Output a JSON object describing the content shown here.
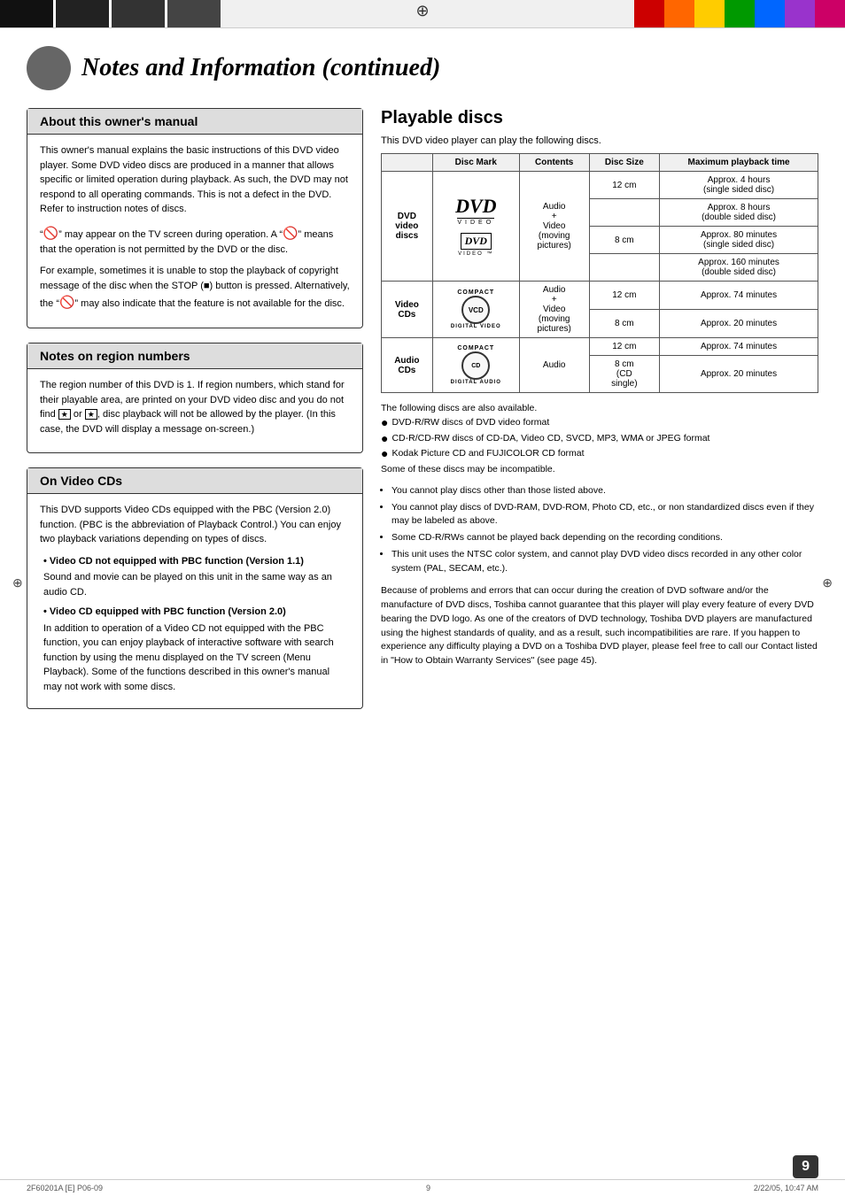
{
  "top_bar": {
    "colors": [
      "#c00",
      "#f60",
      "#fc0",
      "#0a0",
      "#06c",
      "#90c",
      "#c09"
    ]
  },
  "page_title": "Notes and Information (continued)",
  "about_manual": {
    "title": "About this owner's manual",
    "paragraphs": [
      "This owner's manual explains the basic instructions of this DVD video player. Some DVD video discs are produced in a manner that allows specific or limited operation during playback. As such, the DVD may not respond to all operating commands. This is not a defect in the DVD. Refer to instruction notes of discs.",
      "\" \" may appear on the TV screen during operation. A \" \" means that the operation is not permitted by the DVD or the disc.",
      "For example, sometimes it is unable to stop the playback of copyright message of the disc when the STOP (■) button is pressed. Alternatively, the \" \" may also indicate that the feature is not available for the disc."
    ]
  },
  "notes_region": {
    "title": "Notes on region numbers",
    "text": "The region number of this DVD is 1. If region numbers, which stand for their playable area, are printed on your DVD video disc and you do not find  or  , disc playback will not be allowed by the player. (In this case, the DVD will display a message on-screen.)"
  },
  "on_video_cds": {
    "title": "On Video CDs",
    "intro": "This DVD supports Video CDs equipped with the PBC (Version 2.0) function. (PBC is the abbreviation of Playback Control.) You can enjoy two playback variations depending on types of discs.",
    "items": [
      {
        "label": "Video CD not equipped with PBC function (Version 1.1)",
        "text": "Sound and movie can be played on this unit in the same way as an audio CD."
      },
      {
        "label": "Video CD equipped with PBC function (Version 2.0)",
        "text": "In addition to operation of a Video CD not equipped with the PBC function, you can enjoy playback of interactive software with search function by using the menu displayed on the TV screen (Menu Playback). Some of the functions described in this owner's manual may not work with some discs."
      }
    ]
  },
  "playable_discs": {
    "title": "Playable discs",
    "subtitle": "This DVD video player can play the following discs.",
    "table_headers": [
      "",
      "Disc Mark",
      "Contents",
      "Disc Size",
      "Maximum playback time"
    ],
    "rows": [
      {
        "category": "DVD video discs",
        "disc_mark": "DVD VIDEO (large + small)",
        "contents": "Audio + Video (moving pictures)",
        "sizes": [
          {
            "size": "12 cm",
            "times": [
              "Approx. 4 hours (single sided disc)",
              "Approx. 8 hours (double sided disc)"
            ]
          },
          {
            "size": "8 cm",
            "times": [
              "Approx. 80 minutes (single sided disc)",
              "Approx. 160 minutes (double sided disc)"
            ]
          }
        ]
      },
      {
        "category": "Video CDs",
        "disc_mark": "COMPACT VCD DIGITAL VIDEO",
        "contents": "Audio + Video (moving pictures)",
        "sizes": [
          {
            "size": "12 cm",
            "times": [
              "Approx. 74 minutes"
            ]
          },
          {
            "size": "8 cm",
            "times": [
              "Approx. 20 minutes"
            ]
          }
        ]
      },
      {
        "category": "Audio CDs",
        "disc_mark": "COMPACT CD DIGITAL AUDIO",
        "contents": "Audio",
        "sizes": [
          {
            "size": "12 cm",
            "times": [
              "Approx. 74 minutes"
            ]
          },
          {
            "size": "8 cm (CD single)",
            "times": [
              "Approx. 20 minutes"
            ]
          }
        ]
      }
    ],
    "also_available": {
      "intro": "The following discs are also available.",
      "items": [
        "DVD-R/RW discs of DVD video format",
        "CD-R/CD-RW discs of CD-DA, Video CD, SVCD, MP3, WMA or JPEG format",
        "Kodak Picture CD and FUJICOLOR CD format"
      ],
      "note": "Some of these discs may be incompatible."
    },
    "warnings": [
      "You cannot play discs other than those listed above.",
      "You cannot play discs of DVD-RAM, DVD-ROM, Photo CD, etc., or non standardized discs even if they may be labeled as above.",
      "Some CD-R/RWs cannot be played back depending on the recording conditions.",
      "This unit uses the NTSC color system, and cannot play DVD video discs recorded in any other color system (PAL, SECAM, etc.)."
    ],
    "closing_text": "Because of problems and errors that can occur during the creation of DVD software and/or the manufacture of DVD discs, Toshiba cannot guarantee that this player will play every feature of every DVD bearing the DVD logo. As one of the creators of DVD technology, Toshiba DVD players are manufactured using the highest standards of quality, and as a result, such incompatibilities are rare. If you happen to experience any difficulty playing a DVD on a Toshiba DVD player, please feel free to call our Contact listed in \"How to Obtain Warranty Services\" (see page 45)."
  },
  "footer": {
    "left": "2F60201A [E] P06-09",
    "center": "9",
    "right": "2/22/05, 10:47 AM",
    "page_num": "9"
  }
}
